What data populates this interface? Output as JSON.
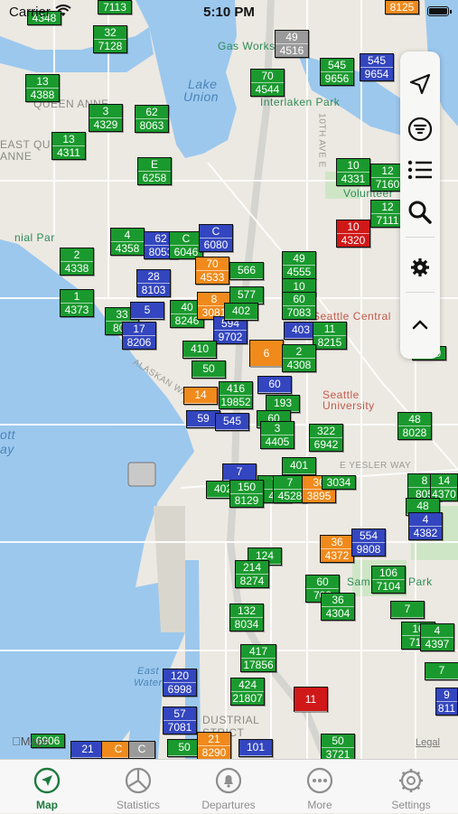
{
  "status_bar": {
    "carrier": "Carrier",
    "time": "5:10 PM"
  },
  "map": {
    "places": [
      {
        "label": "QUEEN ANNE",
        "kind": "area"
      },
      {
        "label": "EAST QUEEN",
        "kind": "area"
      },
      {
        "label": "ANNE",
        "kind": "area"
      },
      {
        "label": "Lake",
        "kind": "water"
      },
      {
        "label": "Union",
        "kind": "water"
      },
      {
        "label": "Gas Works",
        "kind": "poi"
      },
      {
        "label": "Interlaken Park",
        "kind": "poi"
      },
      {
        "label": "Volunteer",
        "kind": "poi"
      },
      {
        "label": "Seattle Central",
        "kind": "red"
      },
      {
        "label": "Seattle",
        "kind": "red"
      },
      {
        "label": "University",
        "kind": "red"
      },
      {
        "label": "E YESLER WAY",
        "kind": "street"
      },
      {
        "label": "ALASKAN WAY",
        "kind": "street"
      },
      {
        "label": "Sam",
        "kind": "poi"
      },
      {
        "label": "Park",
        "kind": "poi"
      },
      {
        "label": "East",
        "kind": "water"
      },
      {
        "label": "Waterway",
        "kind": "water"
      },
      {
        "label": "DUSTRIAL",
        "kind": "area"
      },
      {
        "label": "STRICT",
        "kind": "area"
      },
      {
        "label": "ott",
        "kind": "water"
      },
      {
        "label": "ay",
        "kind": "water"
      },
      {
        "label": "nial Par",
        "kind": "poi"
      },
      {
        "label": "10TH AVE E",
        "kind": "street"
      },
      {
        "label": "Legal",
        "kind": "attr"
      },
      {
        "label": "Maps",
        "kind": "attr"
      }
    ],
    "markers": [
      {
        "route": "",
        "bus": "4348",
        "color": "green"
      },
      {
        "route": "",
        "bus": "7113",
        "color": "green"
      },
      {
        "route": "32",
        "bus": "7128",
        "color": "green"
      },
      {
        "route": "",
        "bus": "8125",
        "color": "orange"
      },
      {
        "route": "49",
        "bus": "4516",
        "color": "gray"
      },
      {
        "route": "545",
        "bus": "9656",
        "color": "green"
      },
      {
        "route": "545",
        "bus": "9654",
        "color": "blue"
      },
      {
        "route": "13",
        "bus": "4388",
        "color": "green"
      },
      {
        "route": "70",
        "bus": "4544",
        "color": "green"
      },
      {
        "route": "3",
        "bus": "4329",
        "color": "green"
      },
      {
        "route": "62",
        "bus": "8063",
        "color": "green"
      },
      {
        "route": "13",
        "bus": "4311",
        "color": "green"
      },
      {
        "route": "E",
        "bus": "6258",
        "color": "green"
      },
      {
        "route": "10",
        "bus": "4331",
        "color": "green"
      },
      {
        "route": "12",
        "bus": "7160",
        "color": "green"
      },
      {
        "route": "12",
        "bus": "7111",
        "color": "green"
      },
      {
        "route": "10",
        "bus": "4320",
        "color": "red"
      },
      {
        "route": "4",
        "bus": "4358",
        "color": "green"
      },
      {
        "route": "62",
        "bus": "8053",
        "color": "blue"
      },
      {
        "route": "C",
        "bus": "6046",
        "color": "green"
      },
      {
        "route": "C",
        "bus": "6080",
        "color": "blue"
      },
      {
        "route": "2",
        "bus": "4338",
        "color": "green"
      },
      {
        "route": "70",
        "bus": "4533",
        "color": "orange"
      },
      {
        "route": "566",
        "bus": "",
        "color": "green"
      },
      {
        "route": "49",
        "bus": "4555",
        "color": "green"
      },
      {
        "route": "28",
        "bus": "8103",
        "color": "blue"
      },
      {
        "route": "1",
        "bus": "4373",
        "color": "green"
      },
      {
        "route": "40",
        "bus": "8246",
        "color": "green"
      },
      {
        "route": "8",
        "bus": "3081",
        "color": "orange"
      },
      {
        "route": "577",
        "bus": "",
        "color": "green"
      },
      {
        "route": "10",
        "bus": "",
        "color": "green"
      },
      {
        "route": "60",
        "bus": "7083",
        "color": "green"
      },
      {
        "route": "33",
        "bus": "800",
        "color": "green"
      },
      {
        "route": "5",
        "bus": "",
        "color": "blue"
      },
      {
        "route": "594",
        "bus": "9702",
        "color": "blue"
      },
      {
        "route": "402",
        "bus": "",
        "color": "green"
      },
      {
        "route": "403",
        "bus": "",
        "color": "blue"
      },
      {
        "route": "11",
        "bus": "8215",
        "color": "green"
      },
      {
        "route": "17",
        "bus": "8206",
        "color": "blue"
      },
      {
        "route": "6",
        "bus": "",
        "color": "orange"
      },
      {
        "route": "2",
        "bus": "4308",
        "color": "green"
      },
      {
        "route": "",
        "bus": "4309",
        "color": "green"
      },
      {
        "route": "410",
        "bus": "",
        "color": "green"
      },
      {
        "route": "50",
        "bus": "",
        "color": "green"
      },
      {
        "route": "416",
        "bus": "19852",
        "color": "green"
      },
      {
        "route": "60",
        "bus": "",
        "color": "blue"
      },
      {
        "route": "193",
        "bus": "",
        "color": "green"
      },
      {
        "route": "14",
        "bus": "",
        "color": "orange"
      },
      {
        "route": "48",
        "bus": "8028",
        "color": "green"
      },
      {
        "route": "59",
        "bus": "",
        "color": "blue"
      },
      {
        "route": "545",
        "bus": "",
        "color": "blue"
      },
      {
        "route": "60",
        "bus": "",
        "color": "green"
      },
      {
        "route": "3",
        "bus": "4405",
        "color": "green"
      },
      {
        "route": "322",
        "bus": "6942",
        "color": "green"
      },
      {
        "route": "401",
        "bus": "",
        "color": "green"
      },
      {
        "route": "7",
        "bus": "",
        "color": "blue"
      },
      {
        "route": "8",
        "bus": "805",
        "color": "green"
      },
      {
        "route": "14",
        "bus": "4370",
        "color": "green"
      },
      {
        "route": "7",
        "bus": "40",
        "color": "green"
      },
      {
        "route": "7",
        "bus": "4528",
        "color": "green"
      },
      {
        "route": "36",
        "bus": "3895",
        "color": "orange"
      },
      {
        "route": "",
        "bus": "3034",
        "color": "orange"
      },
      {
        "route": "402",
        "bus": "",
        "color": "green"
      },
      {
        "route": "150",
        "bus": "8129",
        "color": "green"
      },
      {
        "route": "48",
        "bus": "",
        "color": "green"
      },
      {
        "route": "4",
        "bus": "4382",
        "color": "blue"
      },
      {
        "route": "36",
        "bus": "4372",
        "color": "orange"
      },
      {
        "route": "554",
        "bus": "9808",
        "color": "blue"
      },
      {
        "route": "124",
        "bus": "",
        "color": "green"
      },
      {
        "route": "214",
        "bus": "8274",
        "color": "green"
      },
      {
        "route": "60",
        "bus": "703",
        "color": "green"
      },
      {
        "route": "106",
        "bus": "7104",
        "color": "green"
      },
      {
        "route": "36",
        "bus": "4304",
        "color": "green"
      },
      {
        "route": "7",
        "bus": "",
        "color": "green"
      },
      {
        "route": "10",
        "bus": "710",
        "color": "green"
      },
      {
        "route": "4",
        "bus": "4397",
        "color": "green"
      },
      {
        "route": "132",
        "bus": "8034",
        "color": "green"
      },
      {
        "route": "417",
        "bus": "17856",
        "color": "green"
      },
      {
        "route": "120",
        "bus": "6998",
        "color": "blue"
      },
      {
        "route": "424",
        "bus": "21807",
        "color": "green"
      },
      {
        "route": "11",
        "bus": "",
        "color": "red"
      },
      {
        "route": "7",
        "bus": "",
        "color": "green"
      },
      {
        "route": "9",
        "bus": "811",
        "color": "blue"
      },
      {
        "route": "57",
        "bus": "7081",
        "color": "blue"
      },
      {
        "route": "50",
        "bus": "3721",
        "color": "green"
      },
      {
        "route": "21",
        "bus": "",
        "color": "blue"
      },
      {
        "route": "C",
        "bus": "",
        "color": "orange"
      },
      {
        "route": "C",
        "bus": "",
        "color": "gray"
      },
      {
        "route": "50",
        "bus": "",
        "color": "green"
      },
      {
        "route": "21",
        "bus": "8290",
        "color": "orange"
      },
      {
        "route": "101",
        "bus": "",
        "color": "blue"
      },
      {
        "route": "",
        "bus": "6906",
        "color": "green"
      }
    ]
  },
  "toolbar": {
    "buttons": [
      {
        "icon": "location-arrow-icon"
      },
      {
        "icon": "filter-icon"
      },
      {
        "icon": "list-icon"
      },
      {
        "icon": "search-icon"
      },
      {
        "icon": "gear-icon"
      },
      {
        "icon": "chevron-up-icon"
      }
    ]
  },
  "tabs": [
    {
      "label": "Map",
      "icon": "map-pin-icon",
      "active": true
    },
    {
      "label": "Statistics",
      "icon": "pie-chart-icon",
      "active": false
    },
    {
      "label": "Departures",
      "icon": "bell-icon",
      "active": false
    },
    {
      "label": "More",
      "icon": "more-icon",
      "active": false
    },
    {
      "label": "Settings",
      "icon": "gear-icon",
      "active": false
    }
  ]
}
